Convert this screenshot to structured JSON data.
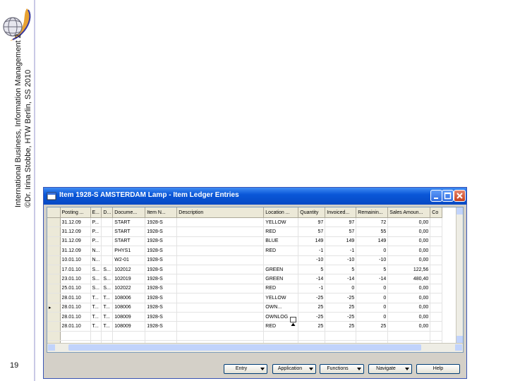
{
  "slide": {
    "footer_line1": "International Business, Information Management 2",
    "footer_line2": "©Dr. Irina Stobbe, HTW Berlin, SS 2010",
    "page_number": "19"
  },
  "window": {
    "title": "Item 1928-S AMSTERDAM Lamp - Item Ledger Entries",
    "columns": [
      "Posting ...",
      "E...",
      "D...",
      "Docume...",
      "Item N...",
      "Description",
      "Location ...",
      "Quantity",
      "Invoiced...",
      "Remainin...",
      "Sales Amoun...",
      "Co"
    ],
    "rows": [
      [
        "31.12.09",
        "P...",
        "",
        "START",
        "1928-S",
        "",
        "YELLOW",
        "97",
        "97",
        "72",
        "0,00",
        ""
      ],
      [
        "31.12.09",
        "P...",
        "",
        "START",
        "1928-S",
        "",
        "RED",
        "57",
        "57",
        "55",
        "0,00",
        ""
      ],
      [
        "31.12.09",
        "P...",
        "",
        "START",
        "1928-S",
        "",
        "BLUE",
        "149",
        "149",
        "149",
        "0,00",
        ""
      ],
      [
        "31.12.09",
        "N...",
        "",
        "PHYS1",
        "1928-S",
        "",
        "RED",
        "-1",
        "-1",
        "0",
        "0,00",
        ""
      ],
      [
        "10.01.10",
        "N...",
        "",
        "W2-01",
        "1928-S",
        "",
        "",
        "-10",
        "-10",
        "-10",
        "0,00",
        ""
      ],
      [
        "17.01.10",
        "S...",
        "S...",
        "102012",
        "1928-S",
        "",
        "GREEN",
        "5",
        "5",
        "5",
        "122,56",
        ""
      ],
      [
        "23.01.10",
        "S...",
        "S...",
        "102019",
        "1928-S",
        "",
        "GREEN",
        "-14",
        "-14",
        "-14",
        "480,40",
        ""
      ],
      [
        "25.01.10",
        "S...",
        "S...",
        "102022",
        "1928-S",
        "",
        "RED",
        "-1",
        "0",
        "0",
        "0,00",
        ""
      ],
      [
        "28.01.10",
        "T...",
        "T...",
        "108006",
        "1928-S",
        "",
        "YELLOW",
        "-25",
        "-25",
        "0",
        "0,00",
        ""
      ],
      [
        "28.01.10",
        "T...",
        "T...",
        "108006",
        "1928-S",
        "",
        "OWN...",
        "25",
        "25",
        "0",
        "0,00",
        ""
      ],
      [
        "28.01.10",
        "T...",
        "T...",
        "108009",
        "1928-S",
        "",
        "OWNLOG",
        "-25",
        "-25",
        "0",
        "0,00",
        ""
      ],
      [
        "28.01.10",
        "T...",
        "T...",
        "108009",
        "1928-S",
        "",
        "RED",
        "25",
        "25",
        "25",
        "0,00",
        ""
      ]
    ],
    "current_row_marker": "▸",
    "buttons": {
      "entry": "Entry",
      "application": "Application",
      "functions": "Functions",
      "navigate": "Navigate",
      "help": "Help"
    }
  },
  "colors": {
    "titlebar": "#0a57d8",
    "window_bg": "#d4d0c8",
    "scroll_thumb": "#c1d3fb"
  },
  "icons": [
    "globe-logo-icon",
    "window-app-icon",
    "minimize-icon",
    "maximize-icon",
    "close-icon",
    "lookup-arrow-icon",
    "dropdown-arrow-icon"
  ]
}
